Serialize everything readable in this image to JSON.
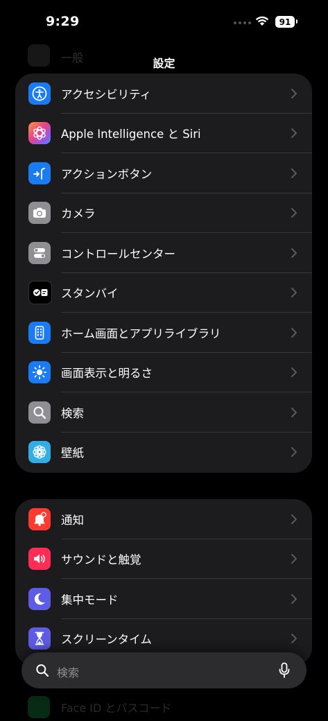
{
  "status": {
    "time": "9:29",
    "battery": "91"
  },
  "header": {
    "title": "設定",
    "ghost_label": "一般"
  },
  "group1": [
    {
      "label": "アクセシビリティ",
      "icon": "accessibility-icon",
      "color": "#1a7cf5"
    },
    {
      "label": "Apple Intelligence と Siri",
      "icon": "apple-intelligence-icon",
      "color": "#c95ac8"
    },
    {
      "label": "アクションボタン",
      "icon": "action-button-icon",
      "color": "#1a7cf5"
    },
    {
      "label": "カメラ",
      "icon": "camera-icon",
      "color": "#8e8e93"
    },
    {
      "label": "コントロールセンター",
      "icon": "control-center-icon",
      "color": "#8e8e93"
    },
    {
      "label": "スタンバイ",
      "icon": "standby-icon",
      "color": "#000000"
    },
    {
      "label": "ホーム画面とアプリライブラリ",
      "icon": "home-screen-icon",
      "color": "#1a7cf5"
    },
    {
      "label": "画面表示と明るさ",
      "icon": "display-brightness-icon",
      "color": "#1a7cf5"
    },
    {
      "label": "検索",
      "icon": "search-icon",
      "color": "#8e8e93"
    },
    {
      "label": "壁紙",
      "icon": "wallpaper-icon",
      "color": "#32ade6"
    }
  ],
  "group2": [
    {
      "label": "通知",
      "icon": "notifications-icon",
      "color": "#ff3b30"
    },
    {
      "label": "サウンドと触覚",
      "icon": "sounds-haptics-icon",
      "color": "#ff2d55"
    },
    {
      "label": "集中モード",
      "icon": "focus-icon",
      "color": "#5e5ce6"
    },
    {
      "label": "スクリーンタイム",
      "icon": "screen-time-icon",
      "color": "#5e5ce6"
    }
  ],
  "search": {
    "placeholder": "検索"
  },
  "footer": {
    "ghost_label": "Face ID とパスコード"
  }
}
